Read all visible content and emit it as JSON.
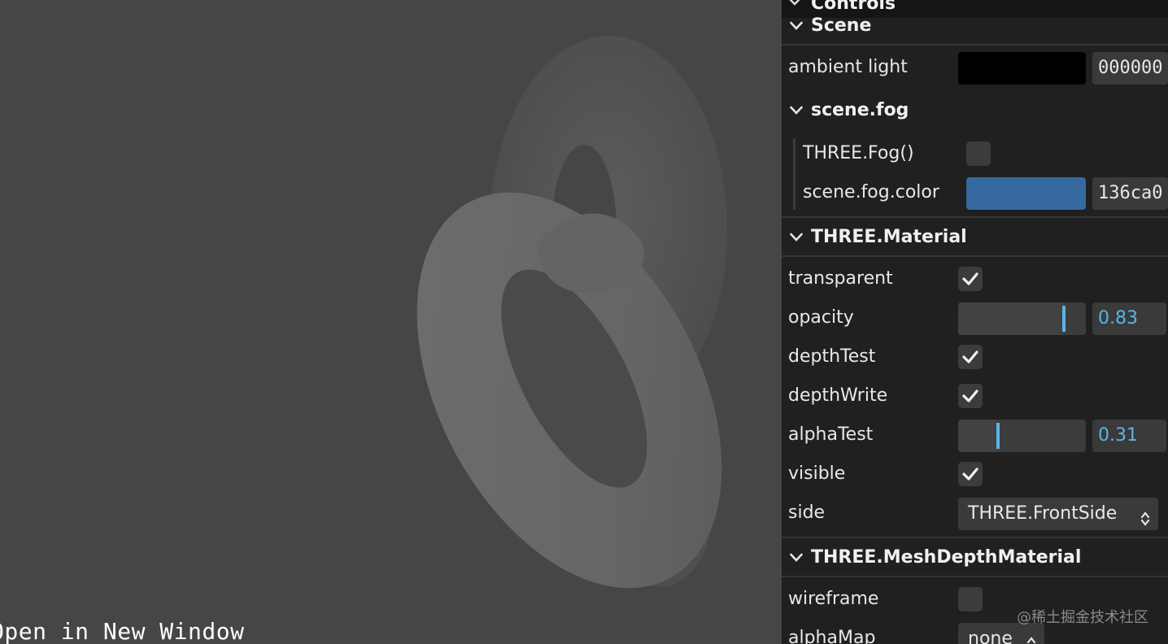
{
  "viewport": {
    "open_link": "Open in New Window"
  },
  "panel": {
    "title": "Controls",
    "scene": {
      "header": "Scene",
      "ambient_light": {
        "label": "ambient light",
        "color": "#000000",
        "hex": "000000"
      }
    },
    "fog": {
      "header": "scene.fog",
      "fog_toggle": {
        "label": "THREE.Fog()",
        "checked": false
      },
      "fog_color": {
        "label": "scene.fog.color",
        "color": "#3569a0",
        "hex": "136ca0"
      }
    },
    "material": {
      "header": "THREE.Material",
      "transparent": {
        "label": "transparent",
        "checked": true
      },
      "opacity": {
        "label": "opacity",
        "value": "0.83",
        "fraction": 0.83
      },
      "depthTest": {
        "label": "depthTest",
        "checked": true
      },
      "depthWrite": {
        "label": "depthWrite",
        "checked": true
      },
      "alphaTest": {
        "label": "alphaTest",
        "value": "0.31",
        "fraction": 0.31
      },
      "visible": {
        "label": "visible",
        "checked": true
      },
      "side": {
        "label": "side",
        "value": "THREE.FrontSide"
      }
    },
    "depth_material": {
      "header": "THREE.MeshDepthMaterial",
      "wireframe": {
        "label": "wireframe",
        "checked": false
      },
      "alphaMap": {
        "label": "alphaMap",
        "value": "none"
      }
    }
  },
  "watermark": "@稀土掘金技术社区"
}
